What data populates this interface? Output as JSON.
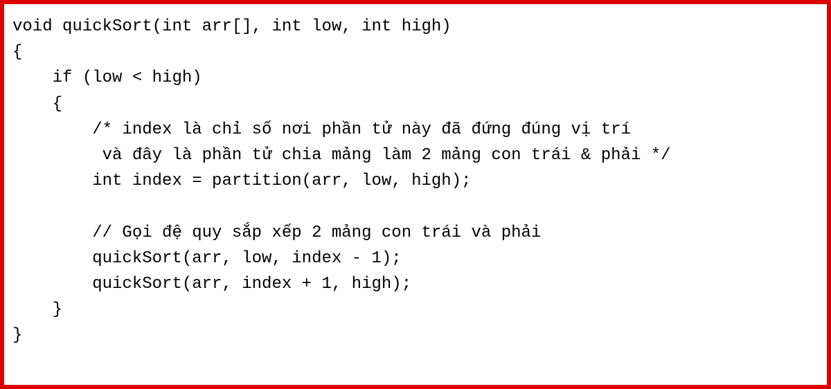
{
  "code": {
    "line1": "void quickSort(int arr[], int low, int high)",
    "line2": "{",
    "line3": "    if (low < high)",
    "line4": "    {",
    "line5": "        /* index là chỉ số nơi phần tử này đã đứng đúng vị trí",
    "line6": "         và đây là phần tử chia mảng làm 2 mảng con trái & phải */",
    "line7": "        int index = partition(arr, low, high);",
    "line8": "",
    "line9": "        // Gọi đệ quy sắp xếp 2 mảng con trái và phải",
    "line10": "        quickSort(arr, low, index - 1);",
    "line11": "        quickSort(arr, index + 1, high);",
    "line12": "    }",
    "line13": "}"
  }
}
